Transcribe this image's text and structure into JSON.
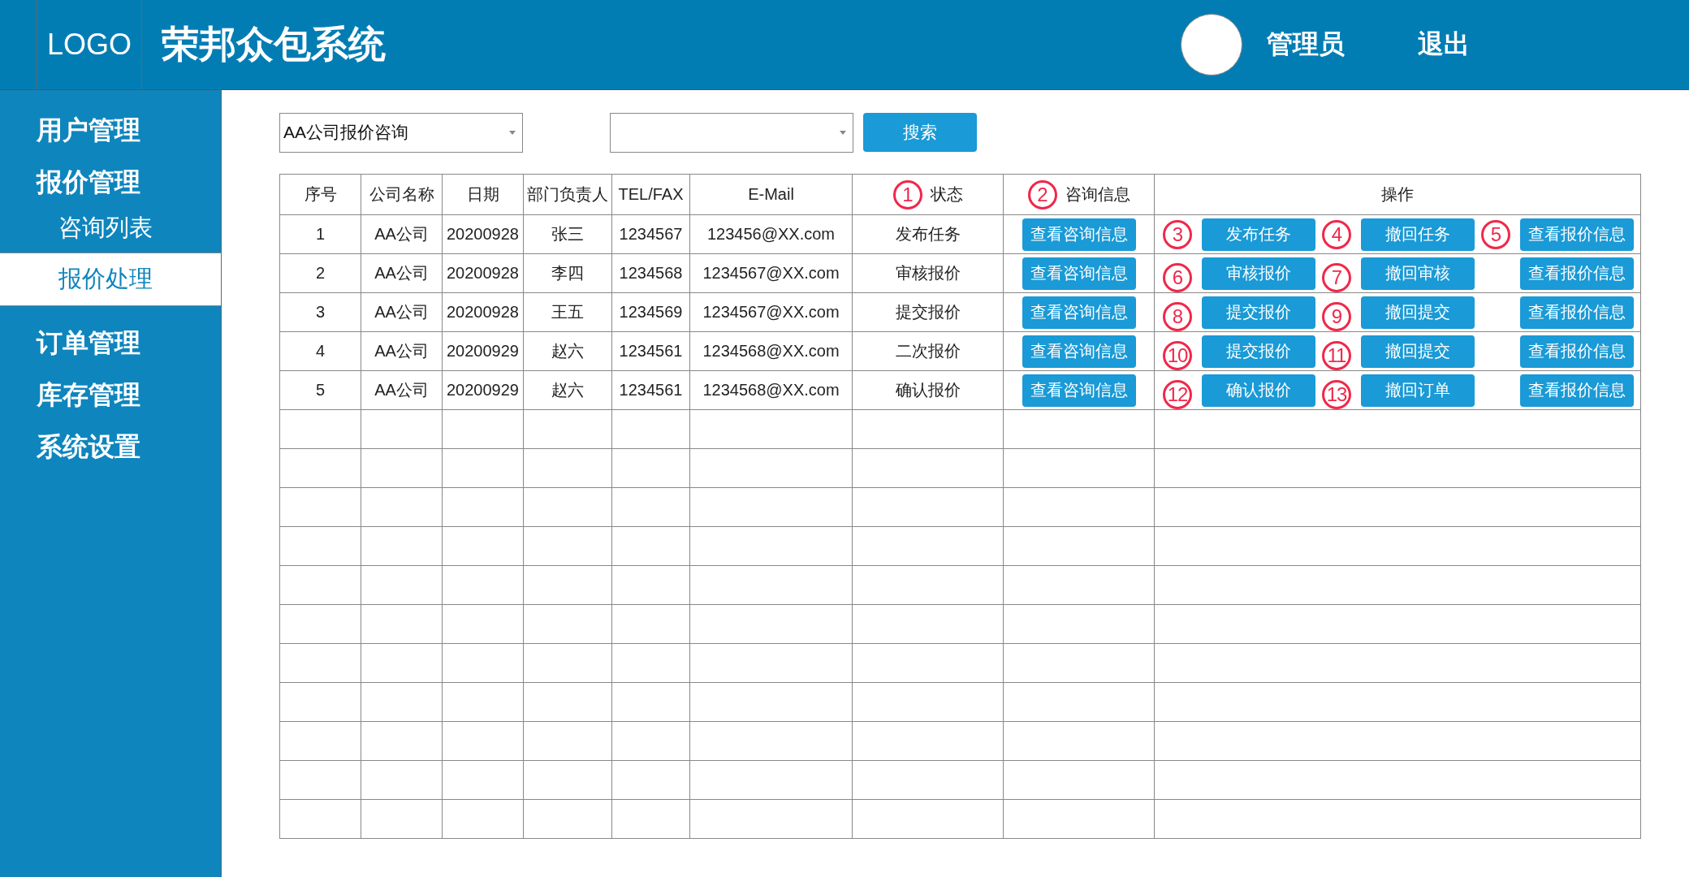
{
  "header": {
    "logo": "LOGO",
    "title": "荣邦众包系统",
    "user": "管理员",
    "logout": "退出"
  },
  "sidebar": {
    "items": [
      {
        "label": "用户管理",
        "selected": false
      },
      {
        "label": "报价管理",
        "selected": false,
        "children": [
          {
            "label": "咨询列表",
            "selected": false
          },
          {
            "label": "报价处理",
            "selected": true
          }
        ]
      },
      {
        "label": "订单管理",
        "selected": false
      },
      {
        "label": "库存管理",
        "selected": false
      },
      {
        "label": "系统设置",
        "selected": false
      }
    ]
  },
  "filters": {
    "select_1": {
      "value": "AA公司报价咨询"
    },
    "search_button": "搜索"
  },
  "table": {
    "columns": [
      {
        "label": "序号"
      },
      {
        "label": "公司名称"
      },
      {
        "label": "日期"
      },
      {
        "label": "部门负责人"
      },
      {
        "label": "TEL/FAX"
      },
      {
        "label": "E-Mail"
      },
      {
        "label": "状态",
        "marker": "1"
      },
      {
        "label": "咨询信息",
        "marker": "2"
      },
      {
        "label": "操作"
      }
    ],
    "rows": [
      {
        "cells": [
          "1",
          "AA公司",
          "20200928",
          "张三",
          "1234567",
          "123456@XX.com",
          "发布任务"
        ],
        "info_button": "查看咨询信息",
        "actions": [
          {
            "marker": "3",
            "label": "发布任务"
          },
          {
            "marker": "4",
            "label": "撤回任务"
          },
          {
            "marker": "5",
            "label": "查看报价信息"
          }
        ]
      },
      {
        "cells": [
          "2",
          "AA公司",
          "20200928",
          "李四",
          "1234568",
          "1234567@XX.com",
          "审核报价"
        ],
        "info_button": "查看咨询信息",
        "actions": [
          {
            "marker": "6",
            "label": "审核报价"
          },
          {
            "marker": "7",
            "label": "撤回审核"
          },
          {
            "label": "查看报价信息"
          }
        ]
      },
      {
        "cells": [
          "3",
          "AA公司",
          "20200928",
          "王五",
          "1234569",
          "1234567@XX.com",
          "提交报价"
        ],
        "info_button": "查看咨询信息",
        "actions": [
          {
            "marker": "8",
            "label": "提交报价"
          },
          {
            "marker": "9",
            "label": "撤回提交"
          },
          {
            "label": "查看报价信息"
          }
        ]
      },
      {
        "cells": [
          "4",
          "AA公司",
          "20200929",
          "赵六",
          "1234561",
          "1234568@XX.com",
          "二次报价"
        ],
        "info_button": "查看咨询信息",
        "actions": [
          {
            "marker": "10",
            "label": "提交报价"
          },
          {
            "marker": "11",
            "label": "撤回提交"
          },
          {
            "label": "查看报价信息"
          }
        ]
      },
      {
        "cells": [
          "5",
          "AA公司",
          "20200929",
          "赵六",
          "1234561",
          "1234568@XX.com",
          "确认报价"
        ],
        "info_button": "查看咨询信息",
        "actions": [
          {
            "marker": "12",
            "label": "确认报价"
          },
          {
            "marker": "13",
            "label": "撤回订单"
          },
          {
            "label": "查看报价信息"
          }
        ]
      }
    ]
  }
}
